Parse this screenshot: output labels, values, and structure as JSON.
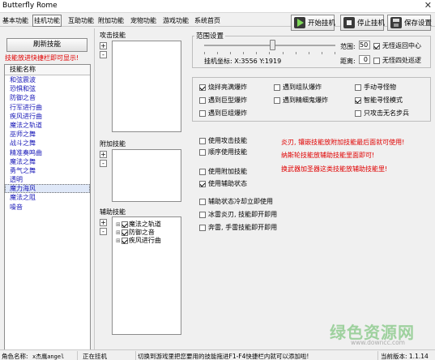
{
  "window": {
    "title": "Butterfly Rome",
    "close_glyph": "✕"
  },
  "menu": [
    "基本功能",
    "挂机功能",
    "互助功能",
    "附加功能",
    "宠物功能",
    "游戏功能",
    "系统首页"
  ],
  "toolbar": {
    "start_label": "开始挂机",
    "stop_label": "停止挂机",
    "save_label": "保存设置",
    "start_color": "#2e7d32",
    "stop_color": "#555555",
    "save_color": "#333333"
  },
  "left": {
    "refresh_label": "刷新技能",
    "tip": "技能放进快捷栏即可显示!",
    "list_header": "技能名称",
    "skills": [
      "和弦震波",
      "恐惧和弦",
      "防御之音",
      "行军进行曲",
      "疾风进行曲",
      "魔法之轨道",
      "巫师之舞",
      "战斗之舞",
      "精准奏鸣曲",
      "魔法之舞",
      "勇气之舞",
      "透明",
      "魔力海风",
      "魔法之阻",
      "噪音"
    ],
    "selected_index": 12
  },
  "middle": {
    "attack_label": "攻击技能",
    "extra_label": "附加技能",
    "assist_label": "辅助技能",
    "plus_glyph": "+",
    "minus_glyph": "-",
    "assist_items": [
      {
        "label": "魔法之轨道",
        "checked": true
      },
      {
        "label": "防御之音",
        "checked": true
      },
      {
        "label": "疾风进行曲",
        "checked": true
      }
    ]
  },
  "range": {
    "title": "范围设置",
    "range_label": "范围:",
    "range_value": "50",
    "slider_fraction": 0.52,
    "coords_label": "挂机坐标: X:3556 Y:1919",
    "distance_label": "距离:",
    "distance_value": "0",
    "no_return_label": "无怪返回中心",
    "no_return_checked": true,
    "no_wander_label": "无怪四处巡逻",
    "no_wander_checked": false
  },
  "options": {
    "col1": [
      {
        "label": "烧拌亮满爆炸",
        "checked": true
      },
      {
        "label": "遇到巨型爆炸",
        "checked": false
      },
      {
        "label": "遇到巨组爆炸",
        "checked": false
      }
    ],
    "col2": [
      {
        "label": "遇到组队爆炸",
        "checked": false
      },
      {
        "label": "遇到精细鬼爆炸",
        "checked": false
      }
    ],
    "col3": [
      {
        "label": "手动寻怪物",
        "checked": false
      },
      {
        "label": "智能寻怪模式",
        "checked": true
      },
      {
        "label": "只攻击无名步兵",
        "checked": false
      }
    ]
  },
  "skill_opts": {
    "use_attack": {
      "label": "使用攻击技能",
      "checked": false
    },
    "order_use": {
      "label": "顺序使用技能",
      "checked": false
    },
    "use_extra": {
      "label": "使用附加技能",
      "checked": false
    },
    "use_assist": {
      "label": "使用辅助状态",
      "checked": true
    },
    "assist_cd": {
      "label": "辅助状态冷却立即使用",
      "checked": false
    },
    "ice_thunder": {
      "label": "冰雷炎刃, 技能即开即用",
      "checked": false
    },
    "hand_thunder": {
      "label": "奔雷, 手雷技能即开即用",
      "checked": false
    }
  },
  "notes": {
    "line1": "炎刃, 镶嵌技能放附加技能最后面就可使用!",
    "line2": "纳斯轮技能放辅助技能里面即可!",
    "line3": "换武器加圣器这类技能放辅助技能里!"
  },
  "status": {
    "role_label": "角色名称:",
    "role_name": "x杰鹰angel",
    "state": "正在挂机",
    "message": "切换到游戏里把您要用的技能拖进F1-F4快捷栏内就可以添加啦!",
    "version_label": "当前版本: 1.1.14"
  },
  "watermark": {
    "text": "绿色资源网",
    "sub": "www.downcc.com",
    "color": "#5cb85c"
  }
}
